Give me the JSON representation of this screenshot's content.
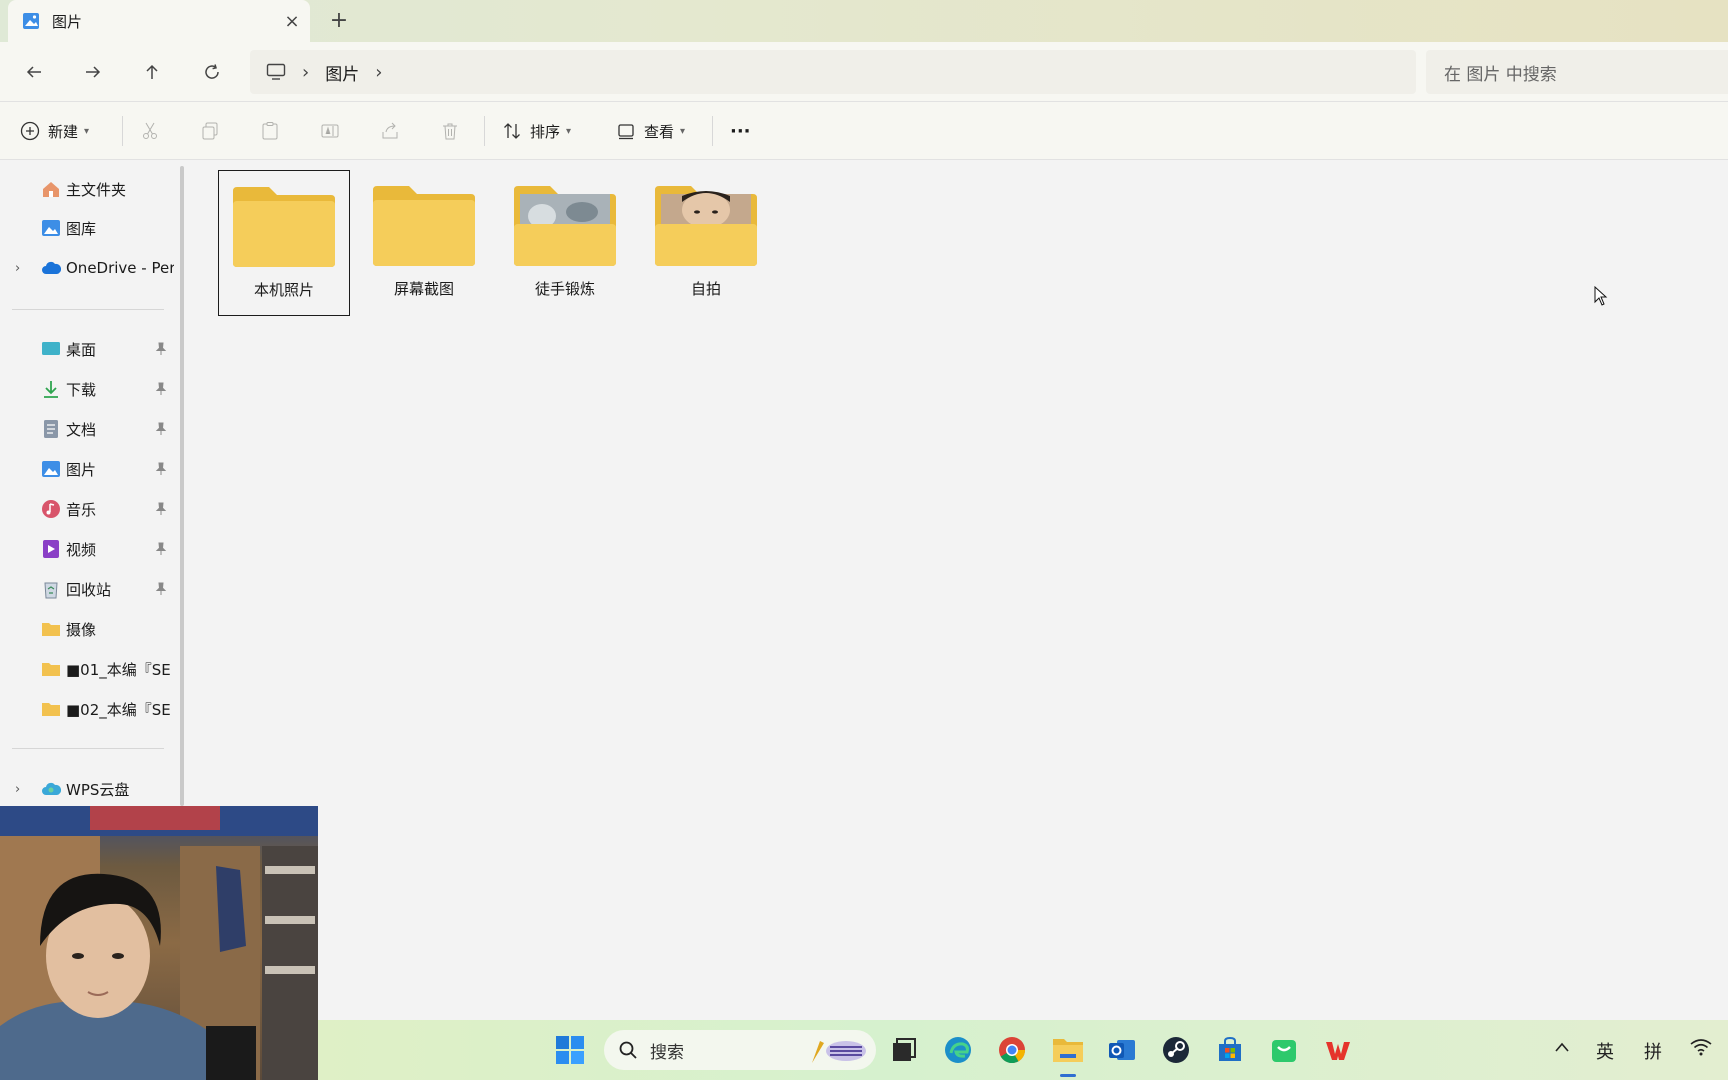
{
  "window": {
    "tab_title": "图片",
    "new_tab": "+",
    "close": "×"
  },
  "navbar": {
    "breadcrumb": [
      "图片"
    ],
    "search_placeholder": "在 图片 中搜索"
  },
  "toolbar": {
    "new_label": "新建",
    "sort_label": "排序",
    "view_label": "查看",
    "more_label": "···"
  },
  "sidebar": {
    "top_items": [
      {
        "label": "主文件夹",
        "icon": "home-icon"
      },
      {
        "label": "图库",
        "icon": "gallery-icon"
      },
      {
        "label": "OneDrive - Per",
        "icon": "cloud-icon"
      }
    ],
    "pinned_items": [
      {
        "label": "桌面",
        "icon": "desktop-icon"
      },
      {
        "label": "下载",
        "icon": "download-icon"
      },
      {
        "label": "文档",
        "icon": "documents-icon"
      },
      {
        "label": "图片",
        "icon": "pictures-icon"
      },
      {
        "label": "音乐",
        "icon": "music-icon"
      },
      {
        "label": "视频",
        "icon": "video-icon"
      },
      {
        "label": "回收站",
        "icon": "recycle-bin-icon"
      },
      {
        "label": "摄像",
        "icon": "folder-icon"
      },
      {
        "label": "■01_本编『SE",
        "icon": "folder-icon"
      },
      {
        "label": "■02_本编『SE",
        "icon": "folder-icon"
      }
    ],
    "bottom_items": [
      {
        "label": "WPS云盘",
        "icon": "wps-cloud-icon"
      }
    ]
  },
  "content": {
    "folders": [
      {
        "label": "本机照片",
        "selected": true
      },
      {
        "label": "屏幕截图",
        "selected": false
      },
      {
        "label": "徒手锻炼",
        "selected": false
      },
      {
        "label": "自拍",
        "selected": false
      }
    ]
  },
  "taskbar": {
    "search_label": "搜索",
    "tray": {
      "lang": "英",
      "ime": "拼"
    }
  },
  "colors": {
    "folder_yellow": "#f5cd5a",
    "folder_back": "#e9b93a",
    "accent": "#2f6fd1"
  }
}
